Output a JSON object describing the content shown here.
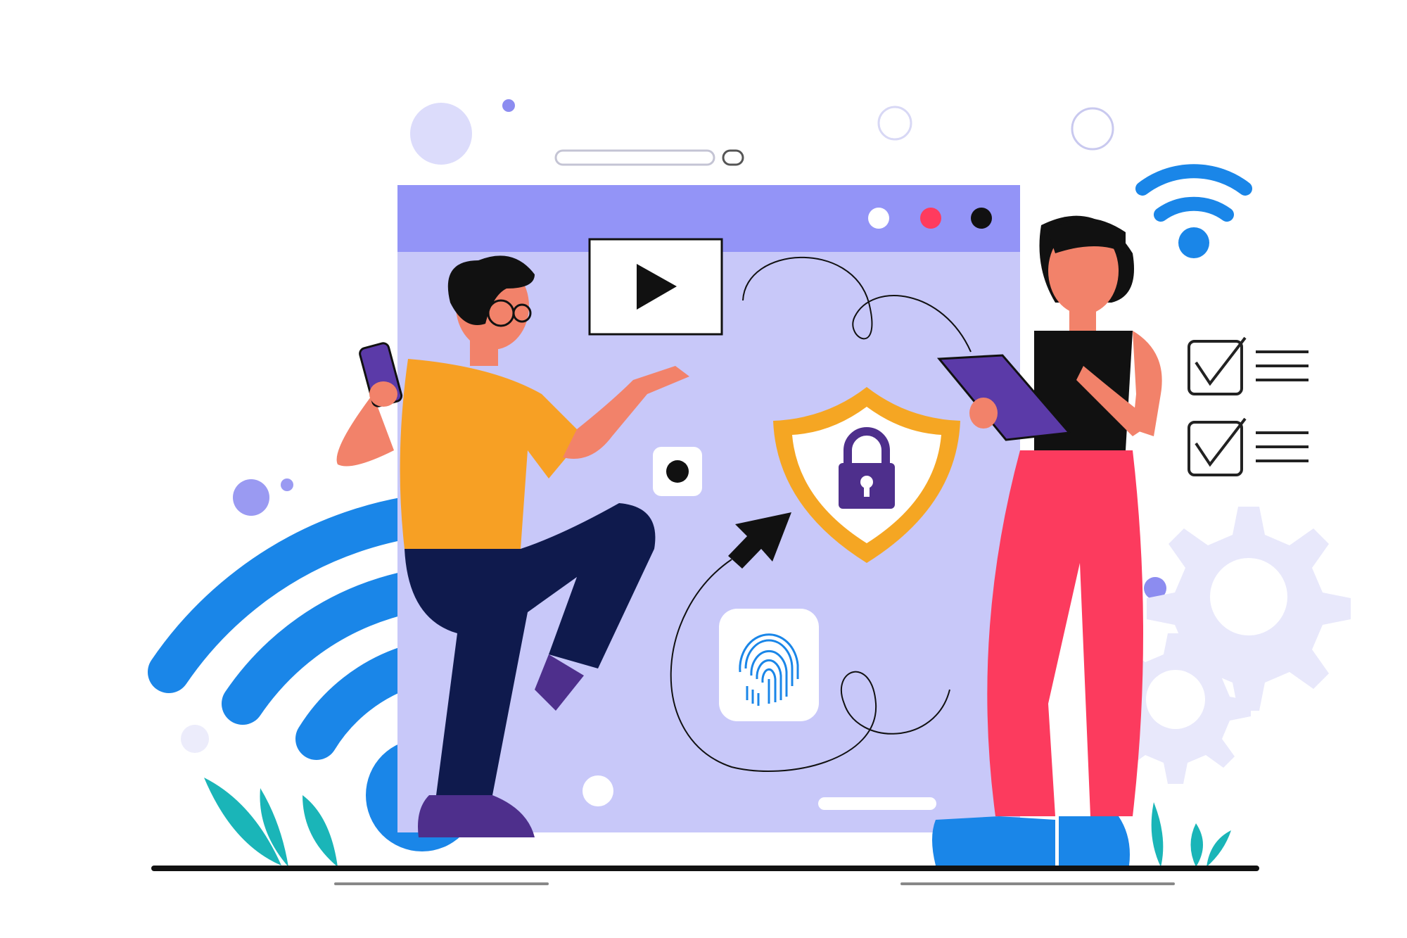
{
  "scene": {
    "description_free": true,
    "colors": {
      "background": "#ffffff",
      "browser_frame": "#9394f7",
      "browser_body": "#c8c8f9",
      "wifi": "#1a86e8",
      "shield": "#f5a623",
      "lock": "#4e2f8c",
      "man_shirt": "#f7a024",
      "man_pants": "#0f1a4d",
      "woman_pants": "#fc3b5e",
      "shoes_blue": "#1a86e8",
      "shoes_purple": "#4e2f8c",
      "skin": "#f2826a",
      "hair": "#141414",
      "plants": "#1ab5b8",
      "gears": "#e8e8fb",
      "bubbles": "#d9d9fc"
    },
    "icons": [
      "play-icon",
      "shield-lock-icon",
      "fingerprint-icon",
      "cursor-arrow-icon",
      "wifi-icon",
      "checklist-icon",
      "gear-icon"
    ]
  }
}
